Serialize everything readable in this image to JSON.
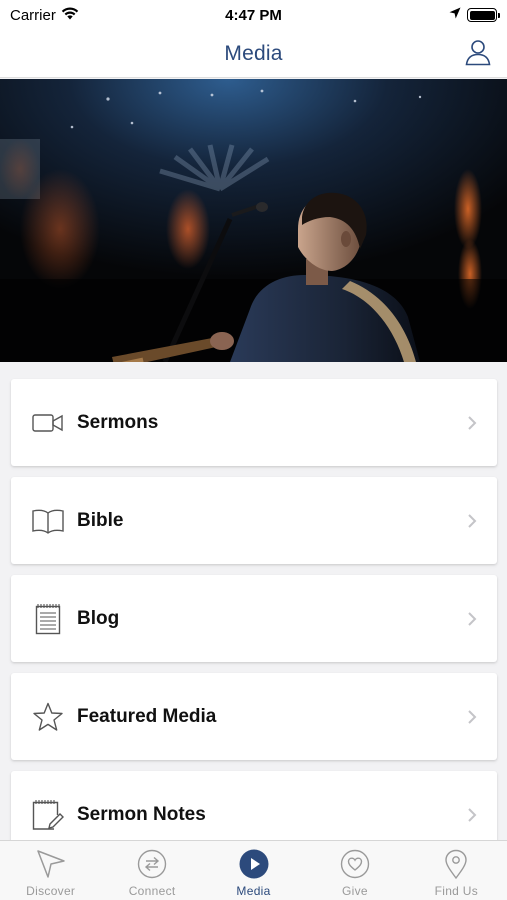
{
  "status_bar": {
    "carrier": "Carrier",
    "time": "4:47 PM"
  },
  "nav": {
    "title": "Media",
    "profile_icon": "person-icon"
  },
  "hero": {
    "icon": "photo-performer-with-guitar"
  },
  "menu": {
    "items": [
      {
        "label": "Sermons",
        "icon": "video-camera-icon"
      },
      {
        "label": "Bible",
        "icon": "open-book-icon"
      },
      {
        "label": "Blog",
        "icon": "notepad-icon"
      },
      {
        "label": "Featured Media",
        "icon": "star-icon"
      },
      {
        "label": "Sermon Notes",
        "icon": "note-pencil-icon"
      }
    ]
  },
  "tab_bar": {
    "tabs": [
      {
        "label": "Discover",
        "icon": "navigation-arrow-icon",
        "active": false
      },
      {
        "label": "Connect",
        "icon": "exchange-arrows-icon",
        "active": false
      },
      {
        "label": "Media",
        "icon": "play-icon",
        "active": true
      },
      {
        "label": "Give",
        "icon": "heart-icon",
        "active": false
      },
      {
        "label": "Find Us",
        "icon": "location-pin-icon",
        "active": false
      }
    ]
  },
  "colors": {
    "accent": "#2c4a7c",
    "inactive": "#9a9a9a",
    "background": "#f2f2f4"
  }
}
